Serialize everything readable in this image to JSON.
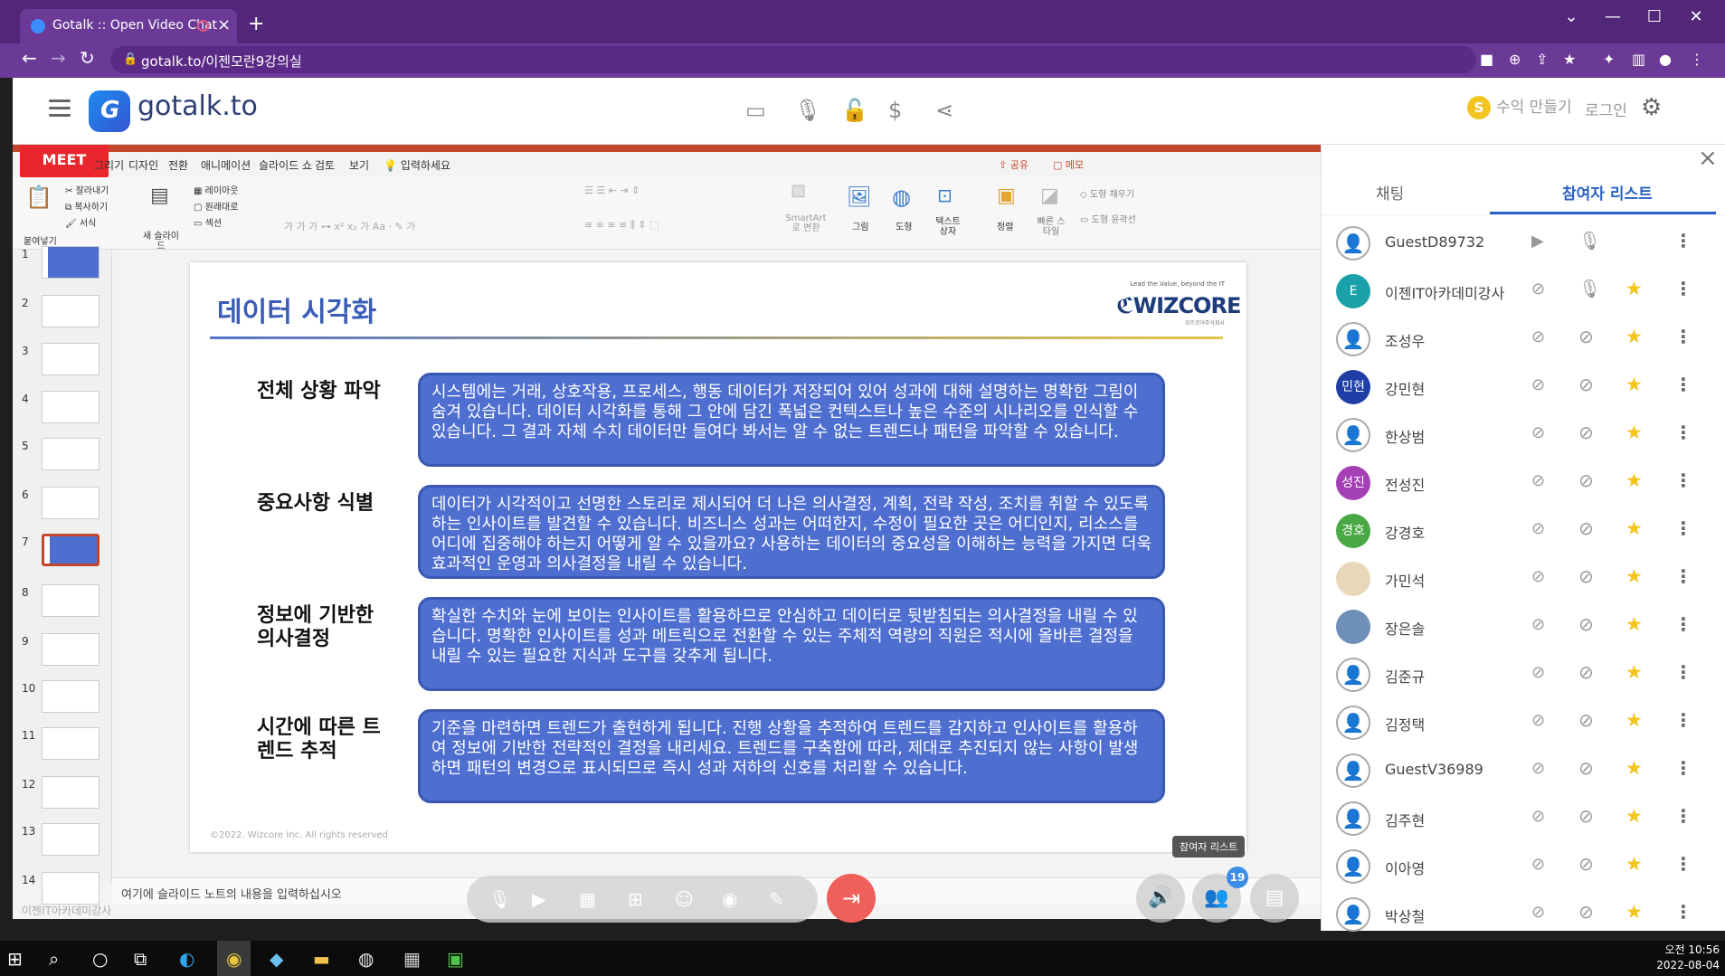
{
  "browser": {
    "tab_title": "Gotalk :: Open Video Chat",
    "new_tab": "+",
    "url": "gotalk.to/이젠모란9강의실"
  },
  "app": {
    "logo_text": "gotalk.to",
    "earn_label": "수익 만들기",
    "coin_symbol": "S",
    "login_label": "로그인"
  },
  "ppt": {
    "meet_label": "MEET",
    "menus": [
      "그리기",
      "디자인",
      "전환",
      "애니메이션",
      "슬라이드 쇼",
      "검토",
      "보기",
      "입력하세요"
    ],
    "share_label": "공유",
    "memo_label": "메모",
    "ribbon": {
      "paste": "붙여넣기",
      "cut": "잘라내기",
      "copy": "복사하기",
      "format": "서식",
      "new_slide": "새 슬라이드",
      "layout": "레이아웃",
      "reset": "원래대로",
      "section": "섹션",
      "smartart": "SmartArt 로 변환",
      "picture": "그림",
      "shape": "도형",
      "textbox": "텍스트 상자",
      "arrange": "정렬",
      "quick_style": "빠른 스타일",
      "shape_fill": "도형 채우기",
      "shape_outline": "도형 윤곽선"
    },
    "thumb_numbers": [
      "1",
      "2",
      "3",
      "4",
      "5",
      "6",
      "7",
      "8",
      "9",
      "10",
      "11",
      "12",
      "13",
      "14"
    ],
    "notes_placeholder": "여기에 슬라이드 노트의 내용을 입력하십시오",
    "watermark": "이젠IT아카데미강사"
  },
  "slide": {
    "title": "데이터 시각화",
    "brand_tagline": "Lead the Value, beyond the IT",
    "brand_name": "WIZCORE",
    "brand_sub": "위즈코어주식회사",
    "sections": [
      {
        "label": "전체 상황 파악",
        "text": "시스템에는 거래, 상호작용, 프로세스, 행동 데이터가 저장되어 있어 성과에 대해 설명하는 명확한 그림이 숨겨 있습니다. 데이터 시각화를 통해 그 안에 담긴 폭넓은 컨텍스트나 높은 수준의 시나리오를 인식할 수 있습니다. 그 결과 자체 수치 데이터만 들여다 봐서는 알 수 없는 트렌드나 패턴을 파악할 수 있습니다."
      },
      {
        "label": "중요사항 식별",
        "text": "데이터가 시각적이고 선명한 스토리로 제시되어 더 나은 의사결정, 계획, 전략 작성, 조치를 취할 수 있도록 하는 인사이트를 발견할 수 있습니다. 비즈니스 성과는 어떠한지, 수정이 필요한 곳은 어디인지, 리소스를 어디에 집중해야 하는지 어떻게 알 수 있을까요? 사용하는 데이터의 중요성을 이해하는 능력을 가지면 더욱 효과적인 운영과 의사결정을 내릴 수 있습니다."
      },
      {
        "label": "정보에 기반한 의사결정",
        "text": "확실한 수치와 눈에 보이는 인사이트를 활용하므로 안심하고 데이터로 뒷받침되는 의사결정을 내릴 수 있습니다. 명확한 인사이트를 성과 메트릭으로 전환할 수 있는 주체적 역량의 직원은 적시에 올바른 결정을 내릴 수 있는 필요한 지식과 도구를 갖추게 됩니다."
      },
      {
        "label": "시간에 따른 트렌드 추적",
        "text": "기준을 마련하면 트렌드가 출현하게 됩니다. 진행 상황을 추적하여 트렌드를 감지하고 인사이트를 활용하여 정보에 기반한 전략적인 결정을 내리세요. 트렌드를 구축함에 따라, 제대로 추진되지 않는 사항이 발생하면 패턴의 변경으로 표시되므로 즉시 성과 저하의 신호를 처리할 수 있습니다."
      }
    ],
    "copyright": "©2022. Wizcore Inc. All rights reserved"
  },
  "controls": {
    "participants_button": "참여자 리스트",
    "participant_count": "19"
  },
  "panel": {
    "tab_chat": "채팅",
    "tab_participants": "참여자 리스트",
    "participants": [
      {
        "name": "GuestD89732",
        "avatar": "",
        "avatar_color": "",
        "cam_on": true,
        "mic_on": true,
        "star": false
      },
      {
        "name": "이젠IT아카데미강사",
        "avatar": "E",
        "avatar_color": "#1aa0a8",
        "cam_on": false,
        "mic_on": true,
        "star": true
      },
      {
        "name": "조성우",
        "avatar": "",
        "avatar_color": "",
        "cam_on": false,
        "mic_on": false,
        "star": true
      },
      {
        "name": "강민현",
        "avatar": "민현",
        "avatar_color": "#1f3fa6",
        "cam_on": false,
        "mic_on": false,
        "star": true
      },
      {
        "name": "한상범",
        "avatar": "",
        "avatar_color": "",
        "cam_on": false,
        "mic_on": false,
        "star": true
      },
      {
        "name": "전성진",
        "avatar": "성진",
        "avatar_color": "#a440b5",
        "cam_on": false,
        "mic_on": false,
        "star": true
      },
      {
        "name": "강경호",
        "avatar": "경호",
        "avatar_color": "#4aa845",
        "cam_on": false,
        "mic_on": false,
        "star": true
      },
      {
        "name": "가민석",
        "avatar": "",
        "avatar_color": "#e8d7b8",
        "cam_on": false,
        "mic_on": false,
        "star": true
      },
      {
        "name": "장은솔",
        "avatar": "",
        "avatar_color": "#6d8fb8",
        "cam_on": false,
        "mic_on": false,
        "star": true
      },
      {
        "name": "김준규",
        "avatar": "",
        "avatar_color": "",
        "cam_on": false,
        "mic_on": false,
        "star": true
      },
      {
        "name": "김정택",
        "avatar": "",
        "avatar_color": "",
        "cam_on": false,
        "mic_on": false,
        "star": true
      },
      {
        "name": "GuestV36989",
        "avatar": "",
        "avatar_color": "",
        "cam_on": false,
        "mic_on": false,
        "star": true
      },
      {
        "name": "김주현",
        "avatar": "",
        "avatar_color": "",
        "cam_on": false,
        "mic_on": false,
        "star": true
      },
      {
        "name": "이아영",
        "avatar": "",
        "avatar_color": "",
        "cam_on": false,
        "mic_on": false,
        "star": true
      },
      {
        "name": "박상철",
        "avatar": "",
        "avatar_color": "",
        "cam_on": false,
        "mic_on": false,
        "star": true
      }
    ]
  },
  "taskbar": {
    "time": "오전 10:56",
    "date": "2022-08-04"
  }
}
